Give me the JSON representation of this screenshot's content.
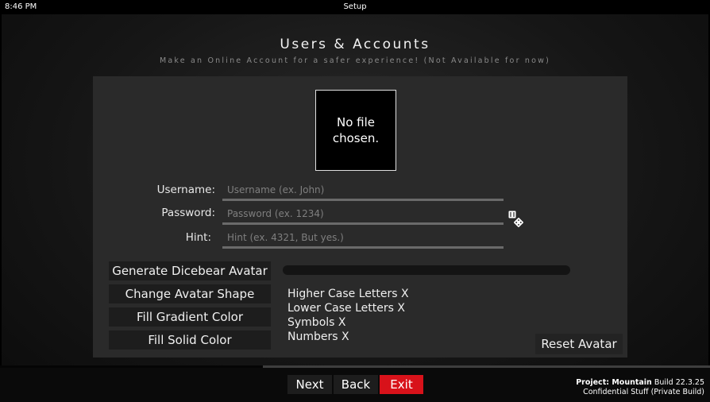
{
  "topbar": {
    "time": "8:46 PM",
    "title": "Setup"
  },
  "page": {
    "heading": "Users & Accounts",
    "subheading": "Make an Online Account for a safer experience! (Not Available for now)"
  },
  "avatar": {
    "status_text": "No file chosen."
  },
  "form": {
    "username": {
      "label": "Username:",
      "placeholder": "Username (ex. John)",
      "value": ""
    },
    "password": {
      "label": "Password:",
      "placeholder": "Password (ex. 1234)",
      "value": ""
    },
    "hint": {
      "label": "Hint:",
      "placeholder": "Hint (ex. 4321, But yes.)",
      "value": ""
    },
    "dice_icon": "dice-icon"
  },
  "avatar_tools": [
    {
      "label": "Generate Dicebear Avatar"
    },
    {
      "label": "Change Avatar Shape"
    },
    {
      "label": "Fill Gradient Color"
    },
    {
      "label": "Fill Solid Color"
    }
  ],
  "password_strength": {
    "level": 0
  },
  "requirements": [
    "Higher Case Letters X",
    "Lower Case Letters X",
    "Symbols X",
    "Numbers X"
  ],
  "reset_avatar_label": "Reset Avatar",
  "setup_progress": {
    "fraction": 0.37
  },
  "nav": {
    "next": "Next",
    "back": "Back",
    "exit": "Exit"
  },
  "build": {
    "project": "Project: Mountain",
    "build": "Build 22.3.25",
    "note": "Confidential Stuff (Private Build)"
  },
  "colors": {
    "exit_button": "#d8121a",
    "panel": "#2a2a2a",
    "background": "#161616"
  }
}
